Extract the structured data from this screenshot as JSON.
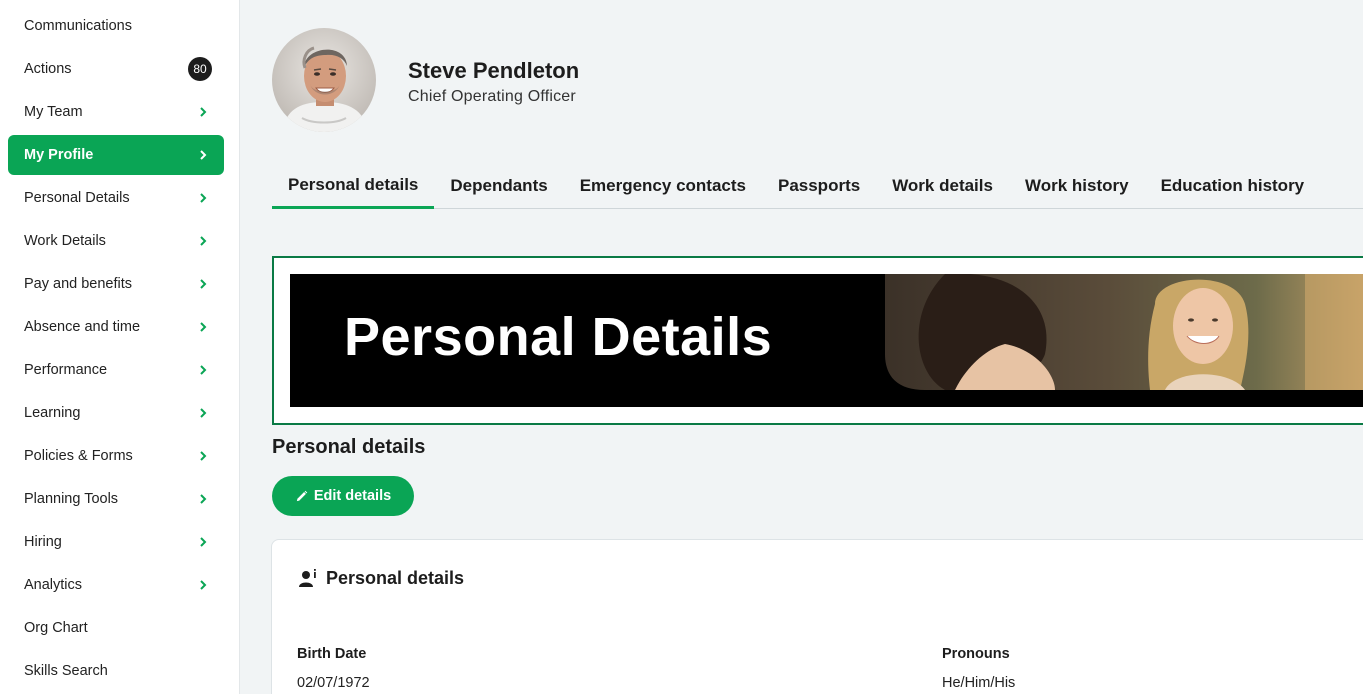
{
  "sidebar": {
    "items": [
      {
        "label": "Communications",
        "chevron": false
      },
      {
        "label": "Actions",
        "badge": "80"
      },
      {
        "label": "My Team",
        "chevron": true
      },
      {
        "label": "My Profile",
        "chevron": true,
        "active": true
      },
      {
        "label": "Personal Details",
        "chevron": true
      },
      {
        "label": "Work Details",
        "chevron": true
      },
      {
        "label": "Pay and benefits",
        "chevron": true
      },
      {
        "label": "Absence and time",
        "chevron": true
      },
      {
        "label": "Performance",
        "chevron": true
      },
      {
        "label": "Learning",
        "chevron": true
      },
      {
        "label": "Policies & Forms",
        "chevron": true
      },
      {
        "label": "Planning Tools",
        "chevron": true
      },
      {
        "label": "Hiring",
        "chevron": true
      },
      {
        "label": "Analytics",
        "chevron": true
      },
      {
        "label": "Org Chart",
        "chevron": false
      },
      {
        "label": "Skills Search",
        "chevron": false
      }
    ]
  },
  "profile": {
    "name": "Steve Pendleton",
    "title": "Chief Operating Officer"
  },
  "tabs": [
    {
      "label": "Personal details",
      "active": true
    },
    {
      "label": "Dependants"
    },
    {
      "label": "Emergency contacts"
    },
    {
      "label": "Passports"
    },
    {
      "label": "Work details"
    },
    {
      "label": "Work history"
    },
    {
      "label": "Education history"
    }
  ],
  "banner": {
    "title": "Personal Details"
  },
  "section": {
    "title": "Personal details",
    "edit_label": "Edit details"
  },
  "card": {
    "title": "Personal details",
    "fields": [
      {
        "label": "Birth Date",
        "value": "02/07/1972"
      },
      {
        "label": "Pronouns",
        "value": "He/Him/His"
      }
    ]
  },
  "colors": {
    "accent": "#0aa555",
    "dark": "#1d1d1d",
    "background": "#f1f4f5"
  }
}
